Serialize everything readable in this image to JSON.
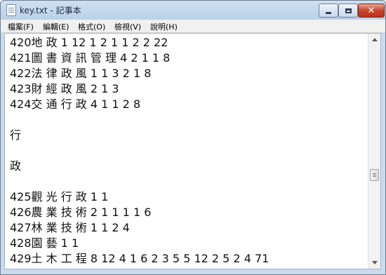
{
  "window": {
    "title": "key.txt - 記事本"
  },
  "menu": {
    "items": [
      "檔案(F)",
      "編輯(E)",
      "格式(O)",
      "檢視(V)",
      "說明(H)"
    ]
  },
  "editor": {
    "lines": [
      "420地 政 1 12 1 2 1 1 2 2 22",
      "421圖 書 資 訊 管 理 4 2 1 1 8",
      "422法 律 政 風 1 1 3 2 1 8",
      "423財 經 政 風 2 1 3",
      "424交 通 行 政 4 1 1 2 8",
      "",
      "行",
      "",
      "政",
      "",
      "425觀 光 行 政 1 1",
      "426農 業 技 術 2 1 1 1 1 6",
      "427林 業 技 術 1 1 2 4",
      "428園 藝 1 1",
      "429土 木 工 程 8 12 4 1 6 2 3 5 5 12 2 5 2 4 71"
    ]
  },
  "controls": {
    "close_glyph": "✕"
  }
}
